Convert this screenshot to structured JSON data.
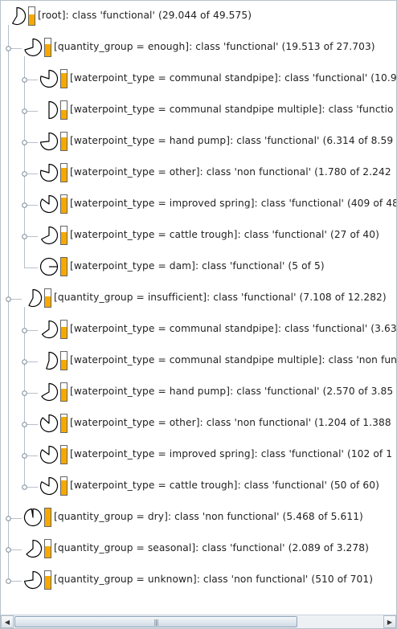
{
  "tree": {
    "nodes": [
      {
        "level": 0,
        "label": "[root]:  class 'functional' (29.044 of 49.575)",
        "ratio": 0.586,
        "toggle": "none"
      },
      {
        "level": 1,
        "label": "[quantity_group = enough]:  class 'functional' (19.513 of 27.703)",
        "ratio": 0.704,
        "toggle": "minus"
      },
      {
        "level": 2,
        "label": "[waterpoint_type = communal standpipe]:  class 'functional' (10.9",
        "ratio": 0.8,
        "toggle": "minus"
      },
      {
        "level": 2,
        "label": "[waterpoint_type = communal standpipe multiple]:  class 'functio",
        "ratio": 0.5,
        "toggle": "minus"
      },
      {
        "level": 2,
        "label": "[waterpoint_type = hand pump]:  class 'functional' (6.314 of 8.59",
        "ratio": 0.735,
        "toggle": "minus"
      },
      {
        "level": 2,
        "label": "[waterpoint_type = other]:  class 'non functional' (1.780 of 2.242",
        "ratio": 0.794,
        "toggle": "minus"
      },
      {
        "level": 2,
        "label": "[waterpoint_type = improved spring]:  class 'functional' (409 of 48",
        "ratio": 0.85,
        "toggle": "minus"
      },
      {
        "level": 2,
        "label": "[waterpoint_type = cattle trough]:  class 'functional' (27 of 40)",
        "ratio": 0.675,
        "toggle": "minus"
      },
      {
        "level": 2,
        "label": "[waterpoint_type = dam]:  class 'functional' (5 of 5)",
        "ratio": 1.0,
        "toggle": "none"
      },
      {
        "level": 1,
        "label": "[quantity_group = insufficient]:  class 'functional' (7.108 of 12.282)",
        "ratio": 0.579,
        "toggle": "minus"
      },
      {
        "level": 2,
        "label": "[waterpoint_type = communal standpipe]:  class 'functional' (3.63",
        "ratio": 0.65,
        "toggle": "minus"
      },
      {
        "level": 2,
        "label": "[waterpoint_type = communal standpipe multiple]:  class 'non fun",
        "ratio": 0.55,
        "toggle": "minus"
      },
      {
        "level": 2,
        "label": "[waterpoint_type = hand pump]:  class 'functional' (2.570 of 3.85",
        "ratio": 0.667,
        "toggle": "minus"
      },
      {
        "level": 2,
        "label": "[waterpoint_type = other]:  class 'non functional' (1.204 of 1.388",
        "ratio": 0.867,
        "toggle": "minus"
      },
      {
        "level": 2,
        "label": "[waterpoint_type = improved spring]:  class 'functional' (102 of 1",
        "ratio": 0.85,
        "toggle": "minus"
      },
      {
        "level": 2,
        "label": "[waterpoint_type = cattle trough]:  class 'functional' (50 of 60)",
        "ratio": 0.833,
        "toggle": "minus"
      },
      {
        "level": 1,
        "label": "[quantity_group = dry]:  class 'non functional' (5.468 of 5.611)",
        "ratio": 0.975,
        "toggle": "plus"
      },
      {
        "level": 1,
        "label": "[quantity_group = seasonal]:  class 'functional' (2.089 of 3.278)",
        "ratio": 0.637,
        "toggle": "plus"
      },
      {
        "level": 1,
        "label": "[quantity_group = unknown]:  class 'non functional' (510 of 701)",
        "ratio": 0.728,
        "toggle": "plus"
      }
    ]
  },
  "colors": {
    "bar_fill": "#f7a800",
    "tree_line": "#b6c1cc",
    "pie_stroke": "#000000"
  },
  "scrollbar": {
    "left_arrow_icon": "◀",
    "right_arrow_icon": "▶",
    "grip_icon": "|||"
  }
}
